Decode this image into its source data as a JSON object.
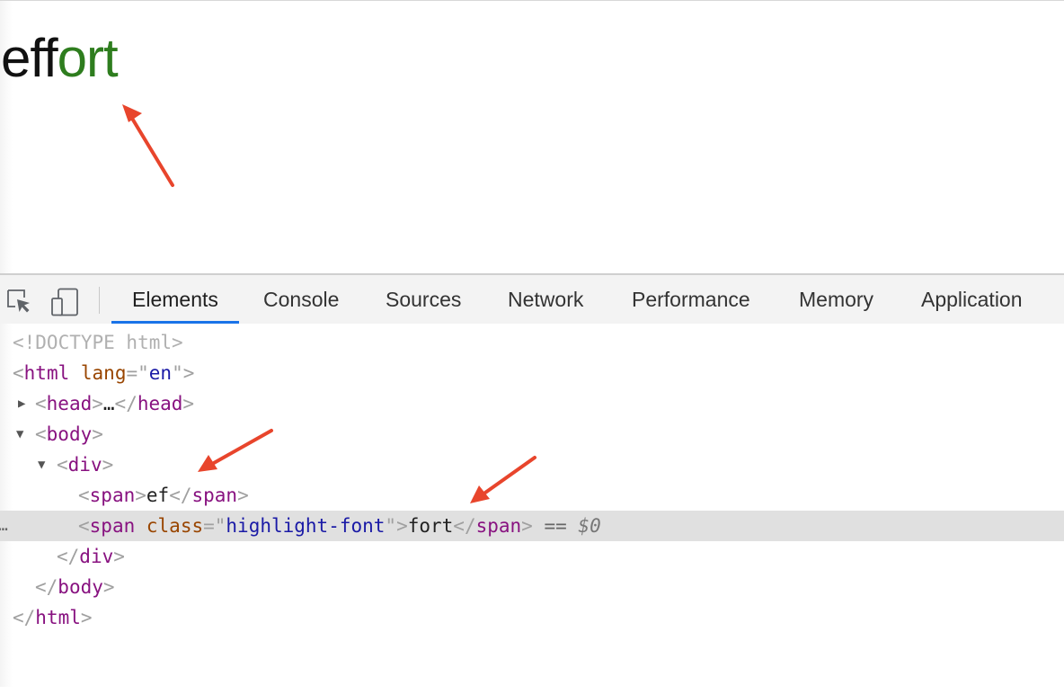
{
  "page": {
    "word_plain": "eff",
    "word_highlight": "ort",
    "highlight_color": "#2e7d1e"
  },
  "devtools": {
    "toolbar": {
      "icons": [
        "inspect-element-icon",
        "device-toolbar-icon"
      ],
      "tabs": [
        {
          "label": "Elements",
          "active": true
        },
        {
          "label": "Console",
          "active": false
        },
        {
          "label": "Sources",
          "active": false
        },
        {
          "label": "Network",
          "active": false
        },
        {
          "label": "Performance",
          "active": false
        },
        {
          "label": "Memory",
          "active": false
        },
        {
          "label": "Application",
          "active": false
        }
      ],
      "accent": "#1a73e8"
    },
    "dom": {
      "doctype": "<!DOCTYPE html>",
      "html_open_tag": "html",
      "html_lang_attr": "lang",
      "html_lang_value": "en",
      "head_tag": "head",
      "head_collapsed": "…",
      "body_tag": "body",
      "div_tag": "div",
      "span_tag": "span",
      "span1_text": "ef",
      "span2_attr": "class",
      "span2_attr_value": "highlight-font",
      "span2_text": "fort",
      "selected_marker": "== ",
      "selected_var": "$0",
      "gutter_ellipsis": "…"
    }
  },
  "annotation_color": "#e8452c"
}
